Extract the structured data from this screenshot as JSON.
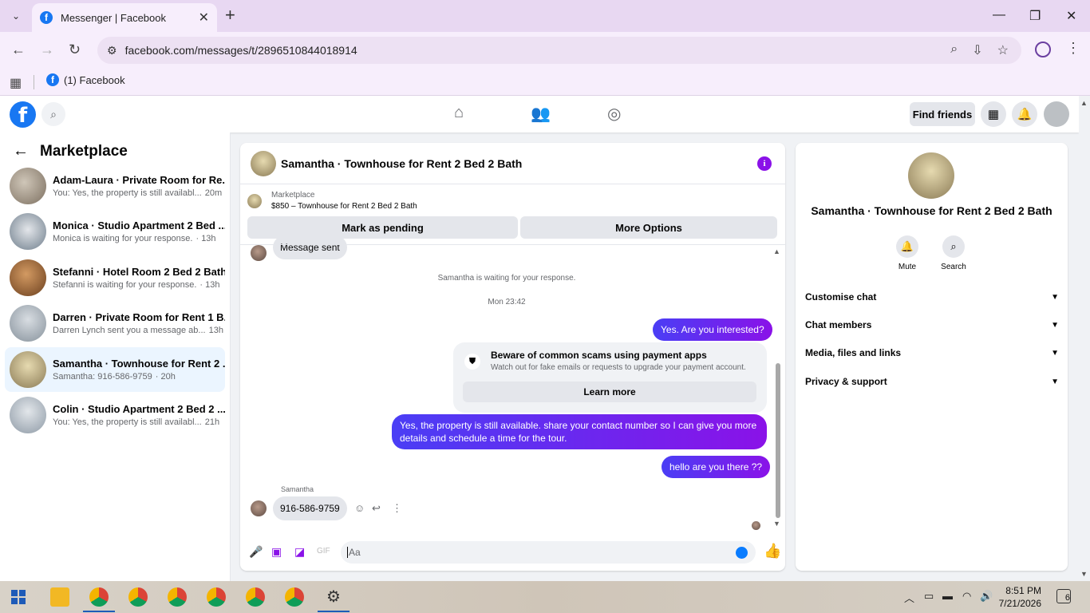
{
  "browser": {
    "tab_title": "Messenger | Facebook",
    "url": "facebook.com/messages/t/2896510844018914",
    "bookmark_label": "(1) Facebook"
  },
  "fb_nav": {
    "find_friends": "Find friends"
  },
  "sidebar": {
    "title": "Marketplace",
    "conversations": [
      {
        "name": "Adam-Laura · Private Room for Re...",
        "message": "You: Yes, the property is still availabl...",
        "time": "20m"
      },
      {
        "name": "Monica · Studio Apartment 2 Bed ...",
        "message": "Monica is waiting for your response.",
        "time": "· 13h"
      },
      {
        "name": "Stefanni · Hotel Room 2 Bed 2 Bath",
        "message": "Stefanni is waiting for your response.",
        "time": "· 13h"
      },
      {
        "name": "Darren · Private Room for Rent 1 B...",
        "message": "Darren Lynch sent you a message ab...",
        "time": "13h"
      },
      {
        "name": "Samantha · Townhouse for Rent 2 ...",
        "message": "Samantha: 916-586-9759",
        "time": "· 20h"
      },
      {
        "name": "Colin · Studio Apartment 2 Bed 2 ...",
        "message": "You: Yes, the property is still availabl...",
        "time": "21h"
      }
    ]
  },
  "chat": {
    "header_name": "Samantha · Townhouse for Rent 2 Bed 2 Bath",
    "marketplace_label": "Marketplace",
    "listing": "$850 – Townhouse for Rent 2 Bed 2 Bath",
    "mark_pending": "Mark as pending",
    "more_options": "More Options",
    "partial_message": "Message sent",
    "waiting_notice": "Samantha is waiting for your response.",
    "timestamp": "Mon 23:42",
    "msg_interested": "Yes. Are you interested?",
    "scam_title": "Beware of common scams using payment apps",
    "scam_desc": "Watch out for fake emails or requests to upgrade your payment account.",
    "learn_more": "Learn more",
    "msg_available": "Yes, the property is still available. share your contact number so I can give you more details and schedule a time for the tour.",
    "msg_there": "hello are you there ??",
    "sender": "Samantha",
    "msg_phone": "916-586-9759",
    "composer_placeholder": "Aa"
  },
  "details": {
    "name": "Samantha · Townhouse for Rent 2 Bed 2 Bath",
    "mute": "Mute",
    "search": "Search",
    "sections": [
      "Customise chat",
      "Chat members",
      "Media, files and links",
      "Privacy & support"
    ]
  },
  "taskbar": {
    "time": "8:51 PM",
    "date": "7/21/2026",
    "notifications": "6"
  },
  "colors": {
    "accent": "#8a12e8",
    "fb_blue": "#1877f2",
    "bubble_gradient_start": "#4a3ef5"
  }
}
